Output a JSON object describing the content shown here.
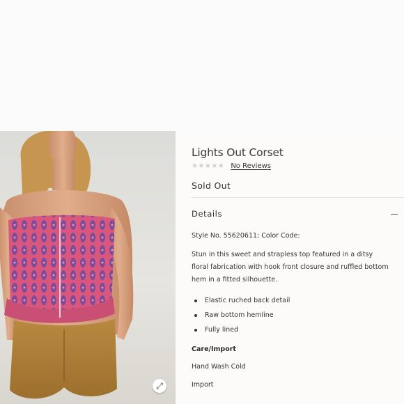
{
  "product": {
    "title": "Lights Out Corset",
    "rating_stars": "★★★★★",
    "reviews_link": "No Reviews",
    "stock_status": "Sold Out"
  },
  "details": {
    "label": "Details",
    "style_line": "Style No. 55620611; Color Code:",
    "description": "Stun in this sweet and strapless top featured in a ditsy floral fabrication with hook front closure and ruffled bottom hem in a fitted silhouette.",
    "features": [
      "Elastic ruched back detail",
      "Raw bottom hemline",
      "Fully lined"
    ],
    "care_heading": "Care/Import",
    "care_lines": [
      "Hand Wash Cold",
      "Import"
    ]
  },
  "icons": {
    "zoom": "expand-icon",
    "collapse": "minus-icon"
  },
  "colors": {
    "page_bg": "#fbfaf9",
    "text": "#2b2b2b",
    "corset_pink": "#d9577e",
    "corset_purple": "#6d4a9c",
    "shorts_tan": "#a87b3a"
  }
}
